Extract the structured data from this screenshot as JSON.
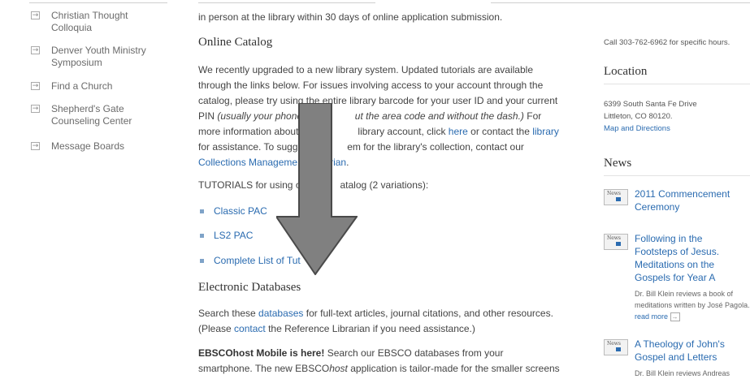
{
  "sidebar": {
    "items": [
      {
        "label": "Christian Thought Colloquia"
      },
      {
        "label": "Denver Youth Ministry Symposium"
      },
      {
        "label": "Find a Church"
      },
      {
        "label": "Shepherd's Gate Counseling Center"
      },
      {
        "label": "Message Boards"
      }
    ]
  },
  "main": {
    "intro_tail": "in person at the library within 30 days of online application submission.",
    "catalog": {
      "heading": "Online Catalog",
      "p1_a": "We recently upgraded to a new library system. Updated tutorials are available through the links below.  For issues involving access to your account through the catalog, please try using the entire library barcode for your user ID and your current PIN ",
      "p1_i": "(usually your phone nu",
      "p1_i2": "ut the area code and without the dash.)",
      "p1_b": " For more information about acces",
      "p1_c": " library account, click ",
      "p1_here": "here",
      "p1_d": " or contact the ",
      "p1_library": "library",
      "p1_e": " for assistance.  To sugges",
      "p1_f": "em for the library's collection, contact our ",
      "p1_link": "Collections Management Librarian",
      "p1_end": ".",
      "tutorials_a": "TUTORIALS for using o",
      "tutorials_b": "atalog (2 variations):",
      "links": [
        "Classic PAC",
        "LS2 PAC",
        "Complete List of Tut"
      ]
    },
    "databases": {
      "heading": "Electronic Databases",
      "p_a": "Search these ",
      "p_link": "databases",
      "p_b": " for full-text articles, journal citations, and other resources.",
      "p_c": "(Please ",
      "p_contact": "contact",
      "p_d": " the Reference Librarian if you need assistance.)",
      "ebsco_bold": "EBSCOhost Mobile is here!",
      "ebsco_a": " Search our EBSCO databases from your",
      "ebsco_b": "smartphone.  The new EBSCO",
      "ebsco_i": "host",
      "ebsco_c": " application is tailor-made for the smaller screens"
    }
  },
  "right": {
    "hours": "Call 303-762-6962 for specific hours.",
    "location_heading": "Location",
    "address1": "6399 South Santa Fe Drive",
    "address2": "Littleton, CO 80120.",
    "map_link": "Map and Directions",
    "news_heading": "News",
    "news_tag": "News",
    "news": [
      {
        "title": "2011 Commencement Ceremony"
      },
      {
        "title": "Following in the Footsteps of Jesus. Meditations on the Gospels for Year A",
        "sub": "Dr. Bill Klein reviews a book of meditations written by José Pagola.",
        "more": "read more"
      },
      {
        "title": "A Theology of John's Gospel and Letters",
        "sub": "Dr. Bill Klein reviews Andreas"
      }
    ]
  },
  "colors": {
    "link": "#2a6bb0",
    "arrow": "#808080"
  }
}
